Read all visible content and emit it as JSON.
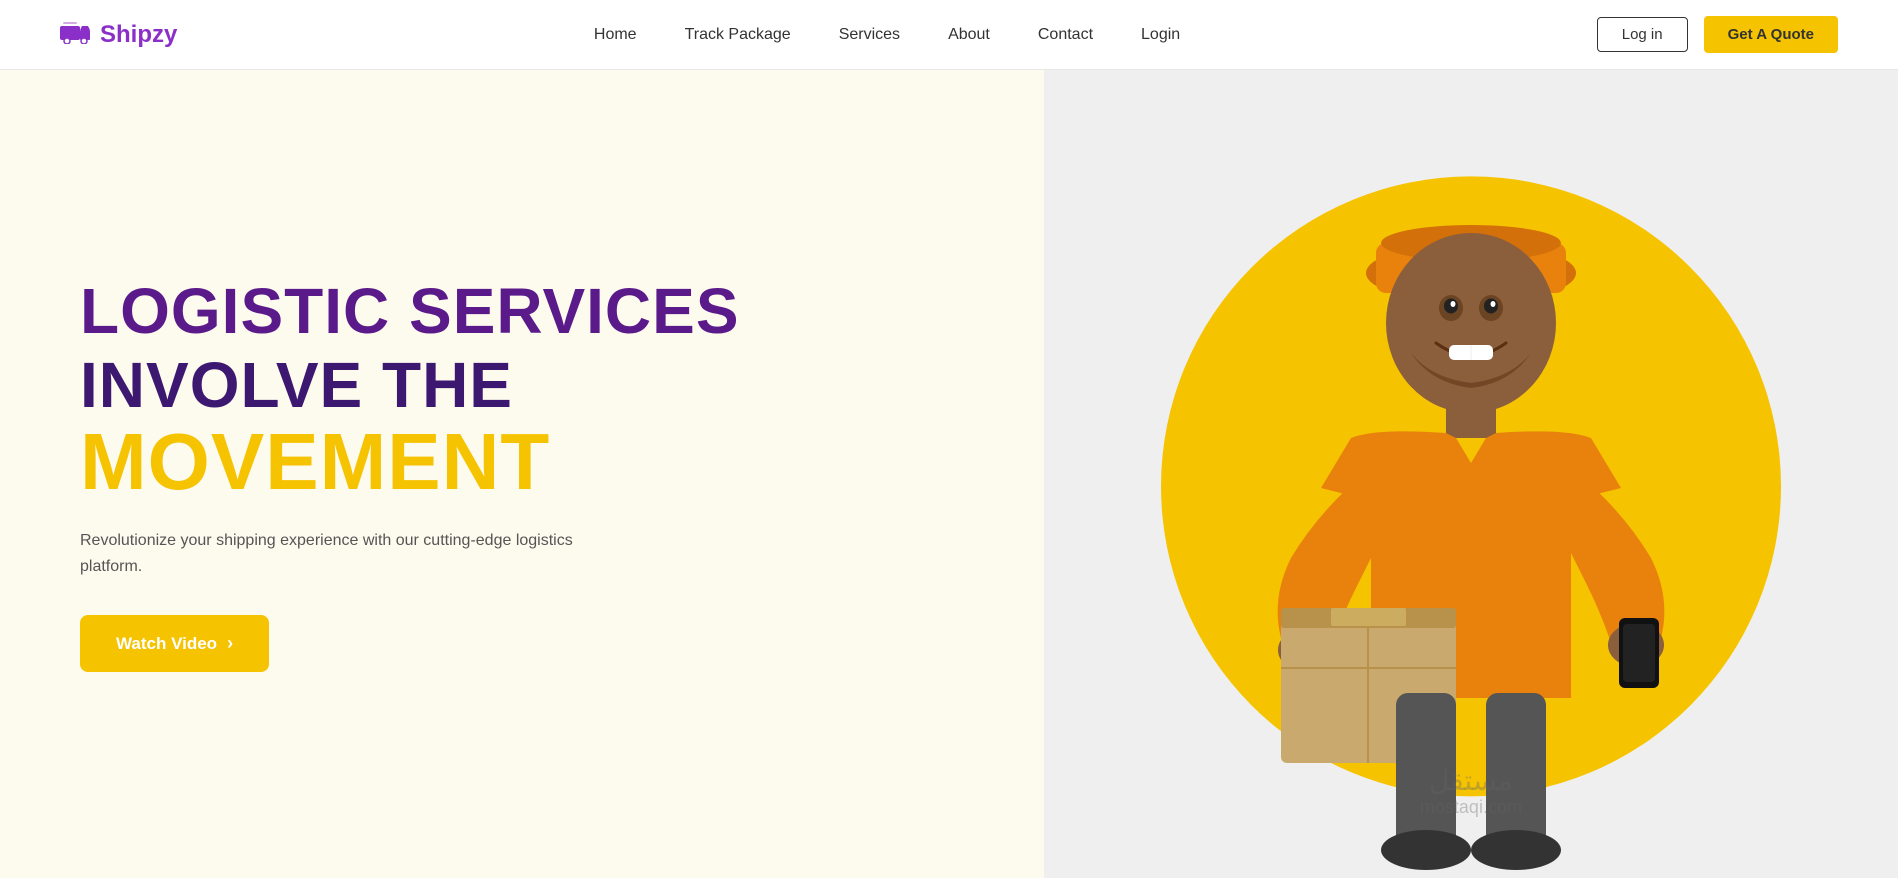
{
  "brand": {
    "name": "Shipzy",
    "icon": "🚚"
  },
  "nav": {
    "items": [
      {
        "label": "Home",
        "id": "home"
      },
      {
        "label": "Track Package",
        "id": "track-package"
      },
      {
        "label": "Services",
        "id": "services"
      },
      {
        "label": "About",
        "id": "about"
      },
      {
        "label": "Contact",
        "id": "contact"
      },
      {
        "label": "Login",
        "id": "login"
      }
    ]
  },
  "header_actions": {
    "login_label": "Log in",
    "quote_label": "Get A Quote"
  },
  "hero": {
    "heading_line1": "LOGISTIC SERVICES",
    "heading_line2": "INVOLVE THE",
    "heading_line3": "MOVEMENT",
    "description": "Revolutionize your shipping experience with our cutting-edge logistics platform.",
    "cta_label": "Watch Video",
    "cta_arrow": "›"
  },
  "colors": {
    "brand_purple": "#8B2FC9",
    "heading_dark_purple": "#3D1870",
    "heading_yellow": "#F5C300",
    "cta_bg": "#F5C300",
    "hero_left_bg": "#FDFAEE",
    "hero_right_bg": "#F0EFEF",
    "yellow_circle": "#F5C300"
  }
}
